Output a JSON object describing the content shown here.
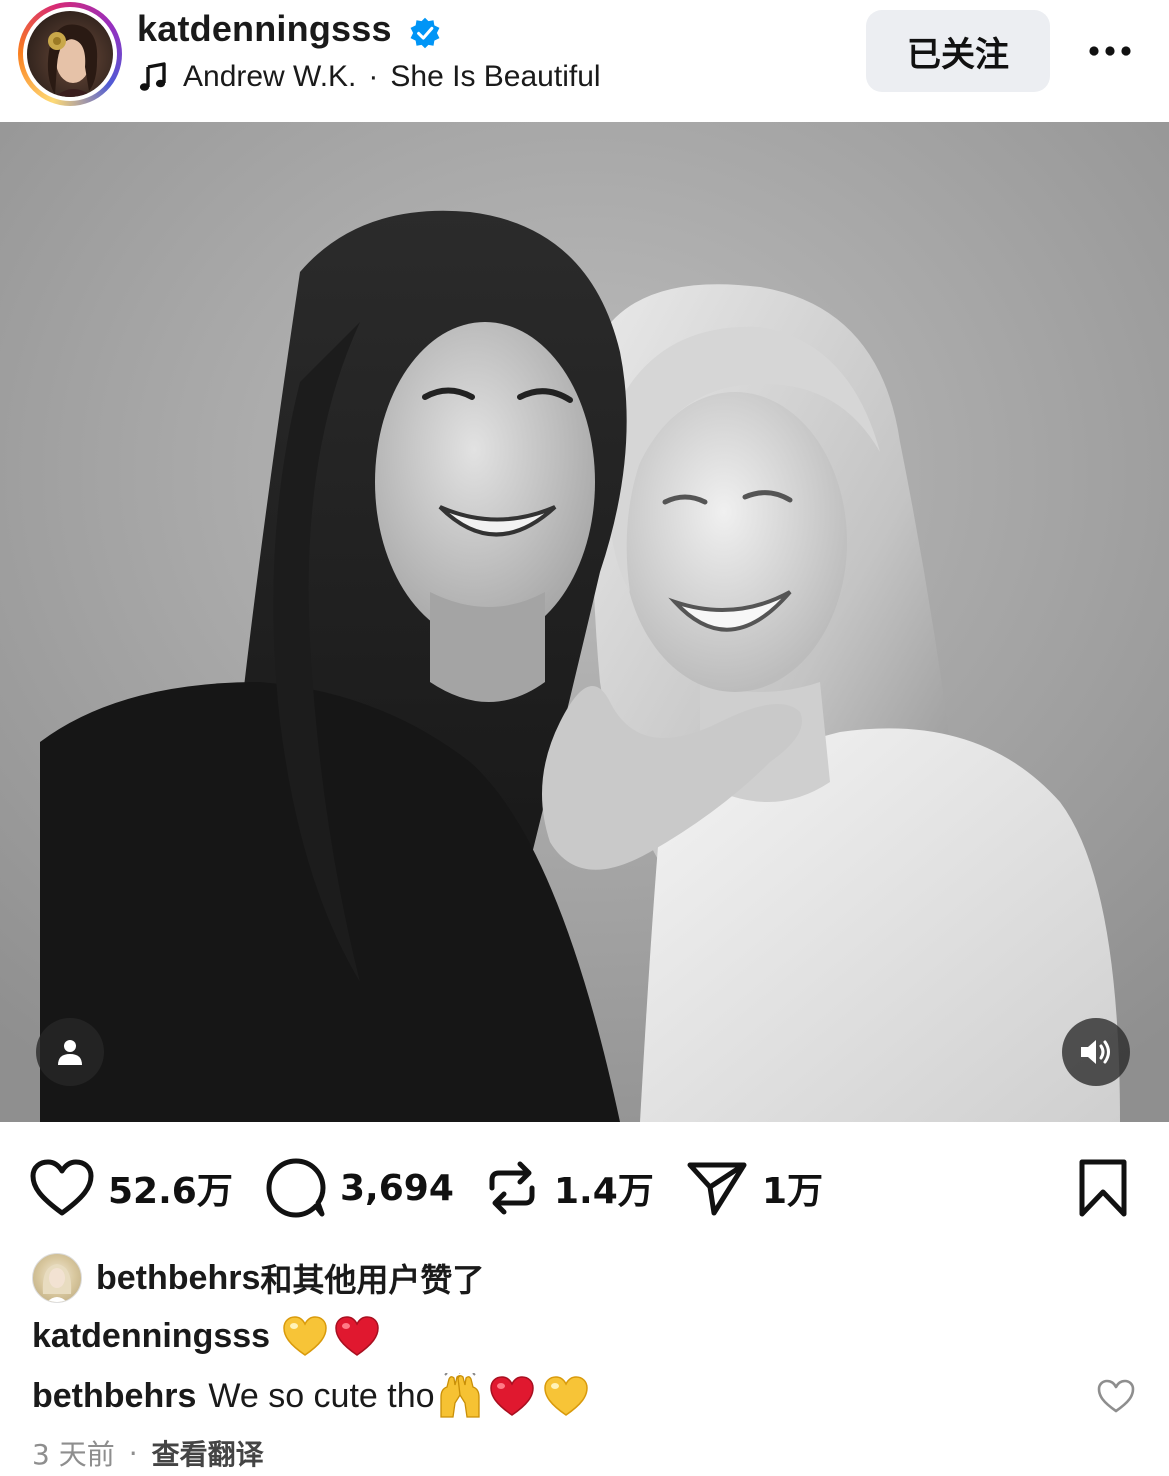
{
  "header": {
    "username": "katdenningsss",
    "verified": true,
    "music_artist": "Andrew W.K.",
    "music_separator": "·",
    "music_title": "She Is Beautiful",
    "follow_label": "已关注"
  },
  "photo": {
    "style": "black-and-white portrait of two smiling women"
  },
  "actions": {
    "likes": "52.6万",
    "comments": "3,694",
    "reposts": "1.4万",
    "shares": "1万"
  },
  "liked_by": {
    "user": "bethbehrs",
    "suffix": "和其他用户赞了"
  },
  "caption": {
    "user": "katdenningsss",
    "emojis": [
      "yellow-heart",
      "red-heart"
    ]
  },
  "comment": {
    "user": "bethbehrs",
    "text": "We so cute tho",
    "emojis": [
      "raising-hands",
      "red-heart",
      "yellow-heart"
    ]
  },
  "meta": {
    "time": "3 天前",
    "separator": "·",
    "translate_label": "查看翻译"
  },
  "colors": {
    "verified_blue": "#0095f6",
    "follow_bg": "#eceef2",
    "heart_red": "#e0182f",
    "heart_yellow": "#f7c437",
    "meta_gray": "#8e8e8e"
  }
}
